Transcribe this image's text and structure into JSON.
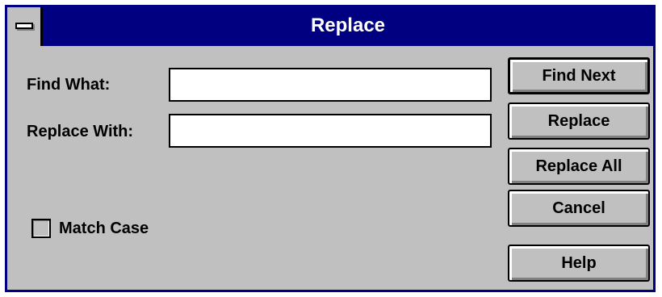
{
  "window": {
    "title": "Replace"
  },
  "fields": {
    "find_label": "Find What:",
    "find_value": "",
    "replace_label": "Replace With:",
    "replace_value": ""
  },
  "options": {
    "match_case_label": "Match Case",
    "match_case_checked": false
  },
  "buttons": {
    "find_next": "Find Next",
    "replace": "Replace",
    "replace_all": "Replace All",
    "cancel": "Cancel",
    "help": "Help"
  },
  "colors": {
    "title_bar": "#000080",
    "face": "#c0c0c0"
  },
  "icons": {
    "system_menu": "system-menu-icon"
  }
}
